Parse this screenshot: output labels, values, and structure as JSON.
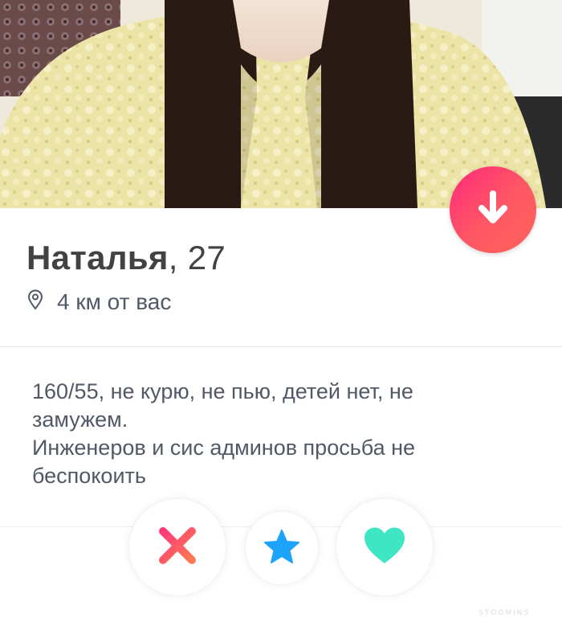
{
  "profile": {
    "name": "Наталья",
    "separator": ",",
    "age": "27",
    "distance": "4 км от вас"
  },
  "bio": {
    "lines": [
      "160/55, не курю, не пью, детей нет, не",
      "замужем.",
      "Инженеров и сис админов просьба не",
      "беспокоить"
    ]
  },
  "watermark": "STOOMINS",
  "colors": {
    "accent_gradient_start": "#fd297b",
    "accent_gradient_end": "#ff655b",
    "super_like": "#1ca4fc",
    "like": "#3ee6c3",
    "text_primary": "#424242",
    "text_secondary": "#505965"
  },
  "icons": {
    "collapse": "arrow-down-icon",
    "location": "location-pin-icon",
    "nope": "x-icon",
    "super_like": "star-icon",
    "like": "heart-icon"
  }
}
